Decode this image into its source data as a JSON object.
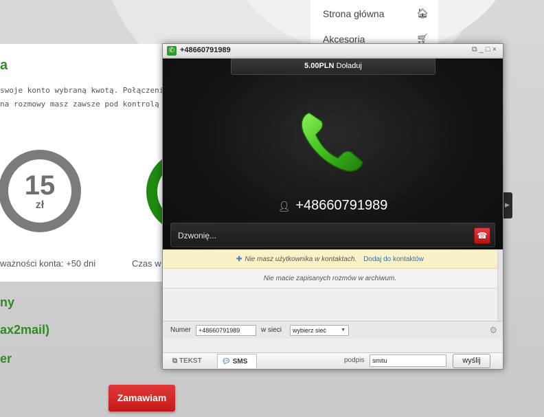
{
  "site": {
    "nav": [
      {
        "label": "Strona główna",
        "icon": "home-icon"
      },
      {
        "label": "Akcesoria",
        "icon": "cart-icon"
      }
    ],
    "card": {
      "title": "a",
      "desc_line1": "swoje konto wybraną kwotą. Połączenia r",
      "desc_line2": "na rozmowy masz zawsze pod kontrolą",
      "amount": "15",
      "unit": "zł",
      "validity": "ważności konta: +50 dni",
      "validity2": "Czas w"
    },
    "links": [
      "ny",
      "ax2mail)",
      "er"
    ],
    "order_button": "Zamawiam"
  },
  "call_window": {
    "title": "+48660791989",
    "balance_amount": "5.00PLN",
    "balance_action": "Doładuj",
    "contact_number": "+48660791989",
    "status": "Dzwonię...",
    "notice_text": "Nie masz użytkownika w kontaktach.",
    "notice_link": "Dodaj do kontaktów",
    "archive_text": "Nie macie zapisanych rozmów w archiwum.",
    "number_label": "Numer",
    "number_value": "+48660791989",
    "network_label": "w sieci",
    "network_value": "wybierz sieć",
    "tab_text": "TEKST",
    "tab_sms": "SMS",
    "signature_label": "podpis",
    "signature_value": "smitu",
    "send_label": "wyślij"
  },
  "colors": {
    "brand_green": "#2c8c1f",
    "hangup_red": "#c31818",
    "order_red": "#d32222"
  }
}
